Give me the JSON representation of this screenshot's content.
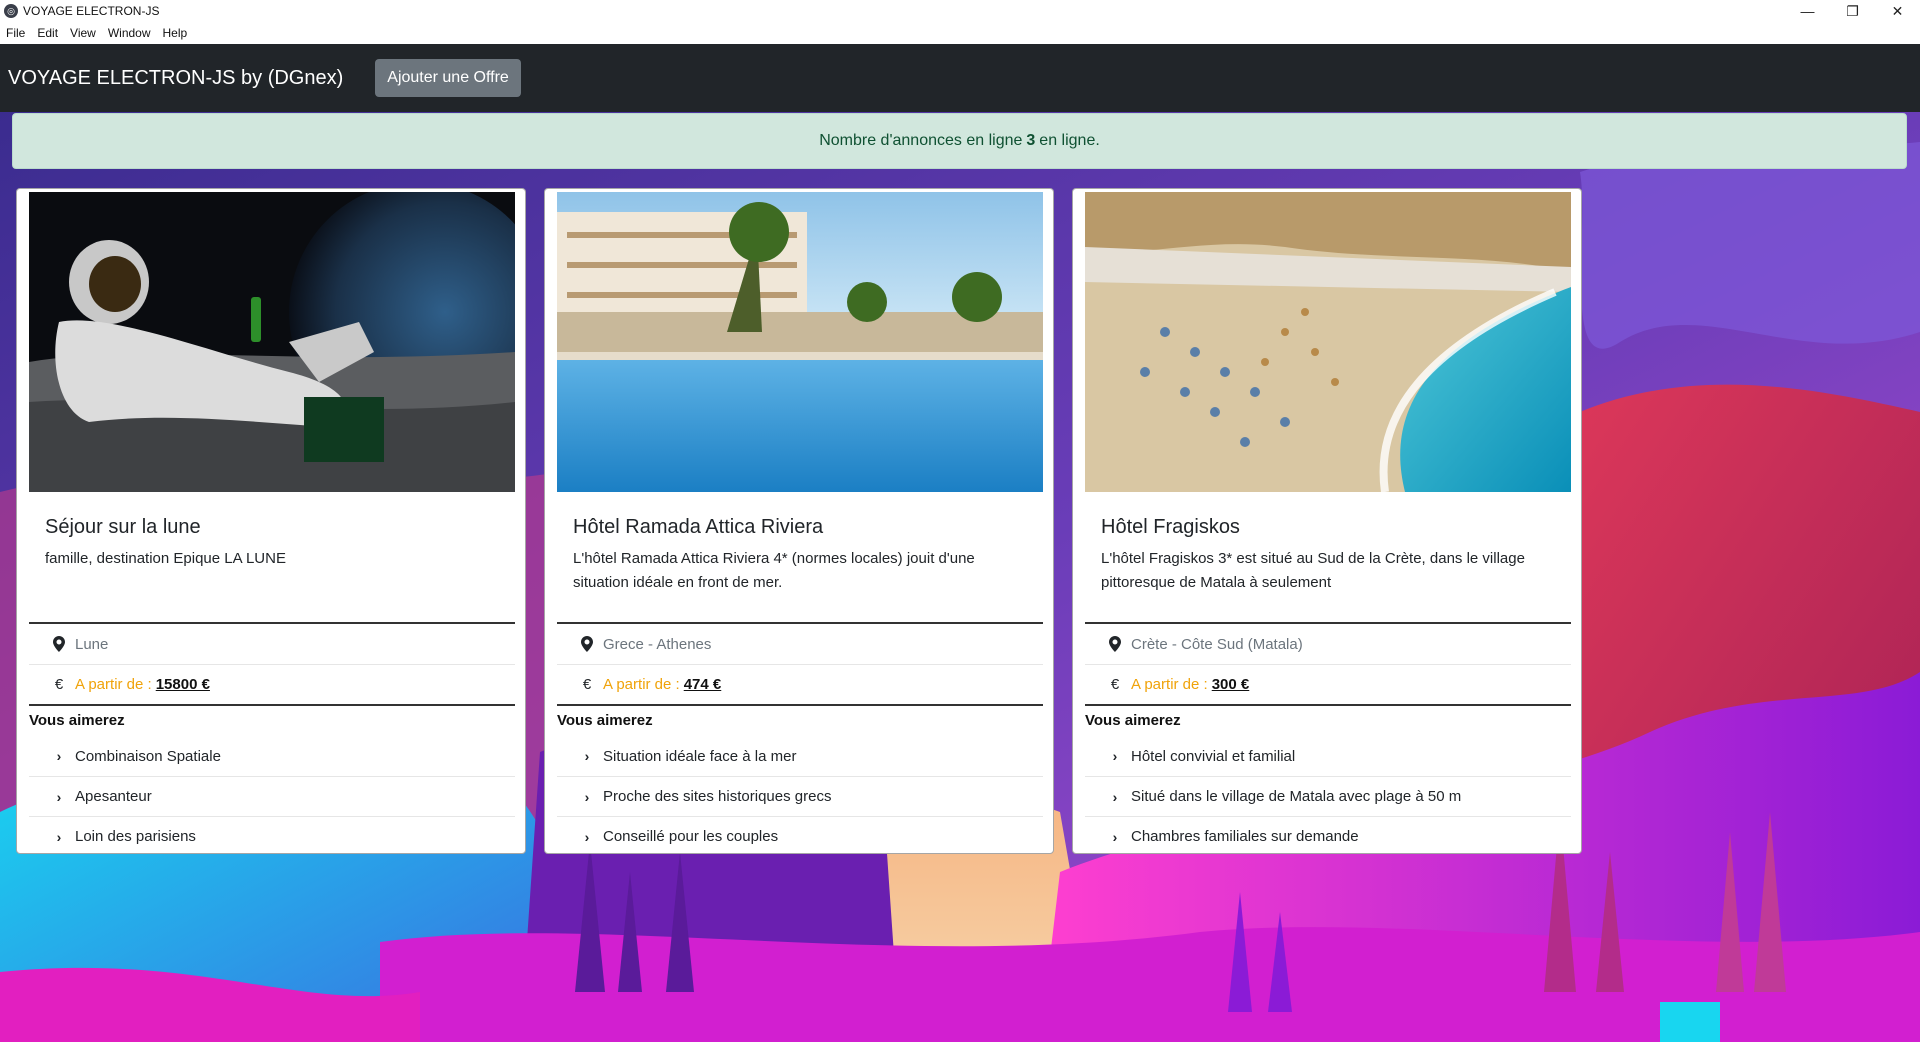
{
  "window": {
    "title": "VOYAGE ELECTRON-JS",
    "menu": [
      "File",
      "Edit",
      "View",
      "Window",
      "Help"
    ]
  },
  "navbar": {
    "brand": "VOYAGE ELECTRON-JS by (DGnex)",
    "add_button": "Ajouter une Offre"
  },
  "alert": {
    "prefix": "Nombre d'annonces en ligne",
    "count": "3",
    "suffix": "en ligne."
  },
  "labels": {
    "price_prefix": "A partir de :",
    "you_will_like": "Vous aimerez",
    "currency_icon": "€"
  },
  "offers": [
    {
      "title": "Séjour sur la lune",
      "description": "famille, destination Epique LA LUNE",
      "location": "Lune",
      "price": "15800 €",
      "image": "astronaut-on-moon",
      "features": [
        "Combinaison Spatiale",
        "Apesanteur",
        "Loin des parisiens"
      ]
    },
    {
      "title": "Hôtel Ramada Attica Riviera",
      "description": "L'hôtel Ramada Attica Riviera 4* (normes locales) jouit d'une situation idéale en front de mer.",
      "location": "Grece - Athenes",
      "price": "474 €",
      "image": "hotel-pool",
      "features": [
        "Situation idéale face à la mer",
        "Proche des sites historiques grecs",
        "Conseillé pour les couples"
      ]
    },
    {
      "title": "Hôtel Fragiskos",
      "description": "L'hôtel Fragiskos 3* est situé au Sud de la Crète, dans le village pittoresque de Matala à seulement",
      "location": "Crète - Côte Sud (Matala)",
      "price": "300 €",
      "image": "beach-matala",
      "features": [
        "Hôtel convivial et familial",
        "Situé dans le village de Matala avec plage à 50 m",
        "Chambres familiales sur demande"
      ]
    }
  ]
}
